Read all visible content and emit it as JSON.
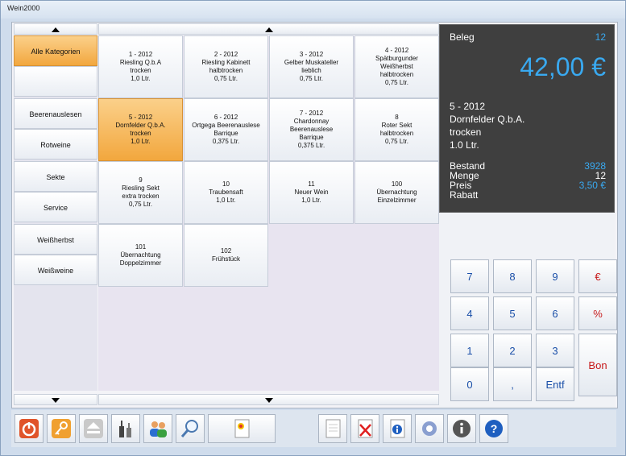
{
  "window": {
    "title": "Wein2000"
  },
  "categories": [
    {
      "label": "Alle Kategorien",
      "active": true
    },
    {
      "label": ""
    },
    {
      "label": "Beerenauslesen"
    },
    {
      "label": "Rotweine"
    },
    {
      "label": "Sekte"
    },
    {
      "label": "Service"
    },
    {
      "label": "Weißherbst"
    },
    {
      "label": "Weißweine"
    }
  ],
  "products": [
    {
      "lines": [
        "1 - 2012",
        "Riesling Q.b.A",
        "trocken",
        "1,0 Ltr."
      ]
    },
    {
      "lines": [
        "2 - 2012",
        "Riesling Kabinett",
        "halbtrocken",
        "0,75 Ltr."
      ]
    },
    {
      "lines": [
        "3 - 2012",
        "Gelber Muskateller",
        "lieblich",
        "0,75 Ltr."
      ]
    },
    {
      "lines": [
        "4 - 2012",
        "Spätburgunder",
        "Weißherbst",
        "halbtrocken",
        "0,75 Ltr."
      ]
    },
    {
      "lines": [
        "5 - 2012",
        "Dornfelder Q.b.A.",
        "trocken",
        "1,0 Ltr."
      ],
      "active": true
    },
    {
      "lines": [
        "6 - 2012",
        "Ortgega Beerenauslese",
        "Barrique",
        "0,375 Ltr."
      ]
    },
    {
      "lines": [
        "7 - 2012",
        "Chardonnay",
        "Beerenauslese",
        "Barrique",
        "0,375 Ltr."
      ]
    },
    {
      "lines": [
        "8",
        "Roter Sekt",
        "halbtrocken",
        "0,75 Ltr."
      ]
    },
    {
      "lines": [
        "9",
        "Riesling Sekt",
        "extra trocken",
        "0,75 Ltr."
      ]
    },
    {
      "lines": [
        "10",
        "Traubensaft",
        "1,0 Ltr."
      ]
    },
    {
      "lines": [
        "11",
        "Neuer Wein",
        "1,0 Ltr."
      ]
    },
    {
      "lines": [
        "100",
        "Übernachtung",
        "Einzelzimmer"
      ]
    },
    {
      "lines": [
        "101",
        "Übernachtung",
        "Doppelzimmer"
      ]
    },
    {
      "lines": [
        "102",
        "Frühstück"
      ]
    }
  ],
  "display": {
    "beleg_label": "Beleg",
    "beleg_number": "12",
    "total": "42,00 €",
    "item_lines": [
      "5 - 2012",
      "Dornfelder Q.b.A.",
      "trocken",
      "1.0 Ltr."
    ],
    "bestand_label": "Bestand",
    "bestand_value": "3928",
    "menge_label": "Menge",
    "menge_value": "12",
    "preis_label": "Preis",
    "preis_value": "3,50 €",
    "rabatt_label": "Rabatt"
  },
  "keypad": {
    "k7": "7",
    "k8": "8",
    "k9": "9",
    "euro": "€",
    "k4": "4",
    "k5": "5",
    "k6": "6",
    "percent": "%",
    "k1": "1",
    "k2": "2",
    "k3": "3",
    "bon": "Bon",
    "k0": "0",
    "comma": ",",
    "entf": "Entf"
  },
  "toolbar": {
    "icons": [
      "power-icon",
      "key-icon",
      "eject-icon",
      "bottles-icon",
      "users-icon",
      "search-icon",
      "new-document-icon",
      "document-icon",
      "delete-document-icon",
      "document-info-icon",
      "settings-icon",
      "info-icon",
      "help-icon"
    ]
  },
  "colors": {
    "accent": "#39a9f0",
    "selected": "#f2a73e",
    "display_bg": "#3f3f3f"
  }
}
